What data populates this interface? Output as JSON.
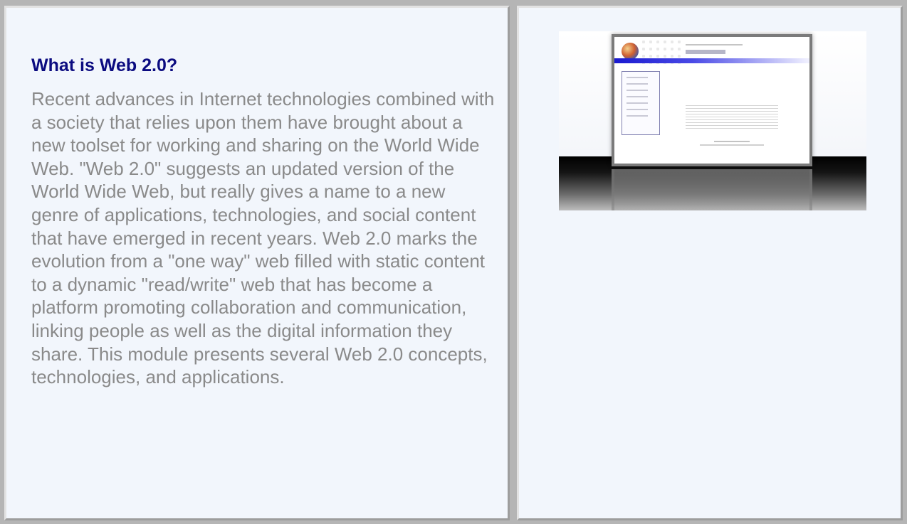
{
  "module": {
    "title": "What is Web 2.0?",
    "description": "Recent advances in Internet technologies combined with a society that relies upon them have brought about a new toolset for working and sharing on the World Wide Web. \"Web 2.0\" suggests an updated version of the World Wide Web, but really gives a name to a new genre of applications, technologies, and social content that have emerged in recent years. Web 2.0 marks the evolution from a \"one way\" web filled with static content to a dynamic \"read/write\" web that has become a platform promoting collaboration and communication, linking people as well as the digital information they share. This module presents several Web 2.0 concepts, technologies, and applications."
  },
  "thumbnail": {
    "depicts": "module-page-preview"
  },
  "colors": {
    "title": "#0b0b80",
    "body_text": "#8a8a8a",
    "panel_background": "#f2f6fc",
    "page_background": "#b5b5b5"
  }
}
